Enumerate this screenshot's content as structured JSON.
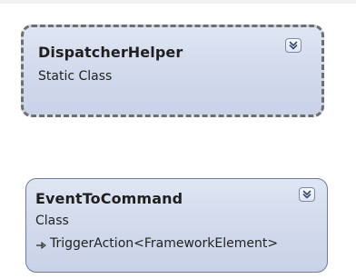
{
  "diagram": {
    "shapes": [
      {
        "name": "DispatcherHelper",
        "kind": "Static Class",
        "expand_icon": "double-chevron-down-icon"
      },
      {
        "name": "EventToCommand",
        "kind": "Class",
        "base_type": "TriggerAction<FrameworkElement>",
        "inheritance_icon": "inheritance-arrow-icon",
        "expand_icon": "double-chevron-down-icon"
      }
    ]
  },
  "colors": {
    "shape_fill_top": "#dfe6f3",
    "shape_fill_bottom": "#c9d2e7",
    "static_border": "#6f6f6f",
    "class_border": "#6f7c97",
    "text": "#1f1f1f"
  }
}
